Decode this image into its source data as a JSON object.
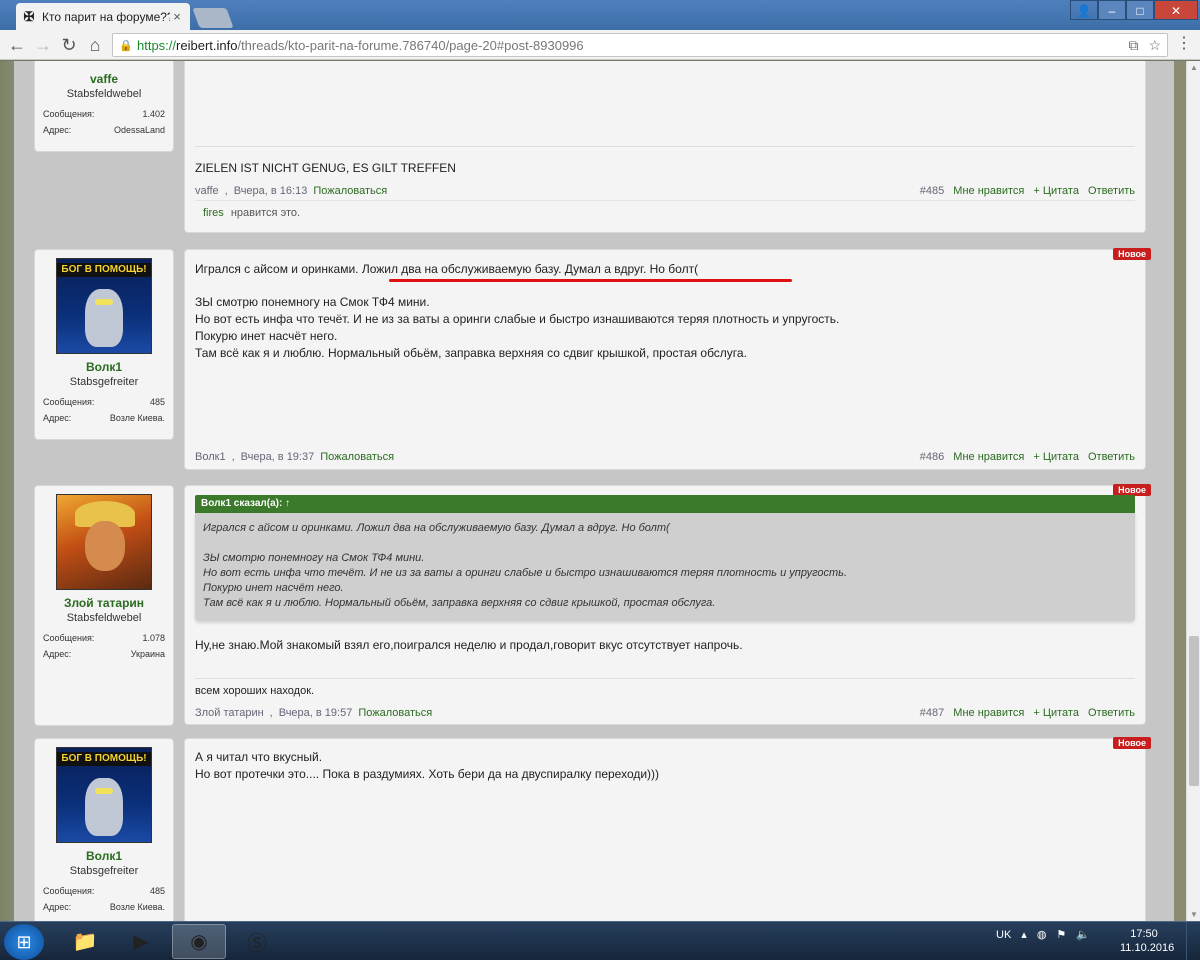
{
  "browser": {
    "tab_title": "Кто парит на форуме???",
    "tab_favicon": "iron-cross-icon",
    "url_scheme": "https://",
    "url_host": "reibert.info",
    "url_path": "/threads/kto-parit-na-forume.786740/page-20#post-8930996"
  },
  "posts": [
    {
      "author": "vaffe",
      "rank": "Stabsfeldwebel",
      "stat_labels": [
        "Сообщения:",
        "Адрес:"
      ],
      "stat_values": [
        "1.402",
        "OdessaLand"
      ],
      "signature": "ZIELEN IST NICHT GENUG, ES GILT TREFFEN",
      "meta_author": "vaffe",
      "meta_date": "Вчера, в 16:13",
      "report": "Пожаловаться",
      "number": "#485",
      "like": "Мне нравится",
      "quote": "+ Цитата",
      "reply": "Ответить",
      "likes_name": "fires",
      "likes_text": "нравится это."
    },
    {
      "author": "Волк1",
      "rank": "Stabsgefreiter",
      "stat_labels": [
        "Сообщения:",
        "Адрес:"
      ],
      "stat_values": [
        "485",
        "Возле Киева."
      ],
      "avatar_text": "БОГ В ПОМОЩЬ!",
      "badge": "Новое",
      "line1_plain": "Игрался с айсом и оринками. ",
      "line1_marked": "Ложил два на обслуживаемую базу. Думал а вдруг. Но болт(",
      "lines": [
        "ЗЫ смотрю понемногу на Смок ТФ4 мини.",
        "Но вот есть инфа что течёт. И не из за ваты а оринги слабые и быстро изнашиваются теряя плотность и упругость.",
        "Покурю инет насчёт него.",
        "Там всё как я и люблю. Нормальный обьём, заправка верхняя со сдвиг крышкой, простая обслуга."
      ],
      "meta_author": "Волк1",
      "meta_date": "Вчера, в 19:37",
      "report": "Пожаловаться",
      "number": "#486",
      "like": "Мне нравится",
      "quote": "+ Цитата",
      "reply": "Ответить"
    },
    {
      "author": "Злой татарин",
      "rank": "Stabsfeldwebel",
      "stat_labels": [
        "Сообщения:",
        "Адрес:"
      ],
      "stat_values": [
        "1.078",
        "Украина"
      ],
      "badge": "Новое",
      "quote_head": "Волк1 сказал(а): ↑",
      "quote_lines": [
        "Игрался с айсом и оринками. Ложил два на обслуживаемую базу. Думал а вдруг. Но болт(",
        "",
        "ЗЫ смотрю понемногу на Смок ТФ4 мини.",
        "Но вот есть инфа что течёт. И не из за ваты а оринги слабые и быстро изнашиваются теряя плотность и упругость.",
        "Покурю инет насчёт него.",
        "Там всё как я и люблю. Нормальный обьём, заправка верхняя со сдвиг крышкой, простая обслуга."
      ],
      "text": "Ну,не знаю.Мой знакомый взял его,поигрался неделю и продал,говорит вкус отсутствует напрочь.",
      "signature": "всем хороших находок.",
      "meta_author": "Злой татарин",
      "meta_date": "Вчера, в 19:57",
      "report": "Пожаловаться",
      "number": "#487",
      "like": "Мне нравится",
      "quote": "+ Цитата",
      "reply": "Ответить"
    },
    {
      "author": "Волк1",
      "rank": "Stabsgefreiter",
      "stat_labels": [
        "Сообщения:",
        "Адрес:"
      ],
      "stat_values": [
        "485",
        "Возле Киева."
      ],
      "avatar_text": "БОГ В ПОМОЩЬ!",
      "badge": "Новое",
      "lines": [
        "А я читал что вкусный.",
        "Но вот протечки это.... Пока в раздумиях. Хоть бери да на двуспиралку переходи)))"
      ]
    }
  ],
  "taskbar": {
    "lang": "UK",
    "time": "17:50",
    "date": "11.10.2016"
  },
  "colors": {
    "accent_green": "#2a6b1f",
    "new_badge": "#c81e1e",
    "quote_header": "#3a7a2a",
    "underline": "#dd1111"
  }
}
